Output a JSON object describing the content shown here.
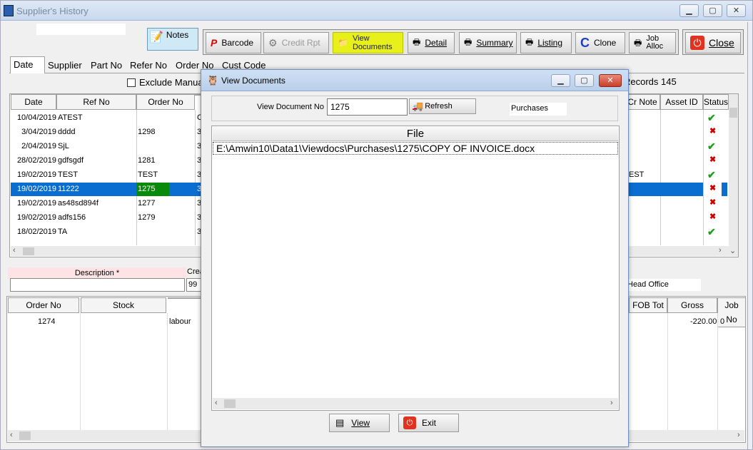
{
  "window": {
    "title": "Supplier's History"
  },
  "toolbar": {
    "notes": "Notes",
    "barcode": "Barcode",
    "credit_rpt": "Credit Rpt",
    "view_docs_line1": "View",
    "view_docs_line2": "Documents",
    "detail": "Detail",
    "summary": "Summary",
    "listing": "Listing",
    "clone": "Clone",
    "job_alloc_line1": "Job",
    "job_alloc_line2": "Alloc",
    "close": "Close"
  },
  "tabs": [
    "Date",
    "Supplier",
    "Part No",
    "Refer No",
    "Order No",
    "Cust Code"
  ],
  "exclude_label": "Exclude Manual",
  "records_label": "Records 145",
  "grid": {
    "headers": {
      "date": "Date",
      "ref": "Ref No",
      "order": "Order No",
      "cr_note": "Cr Note",
      "asset": "Asset ID",
      "status": "Status"
    },
    "rows": [
      {
        "date": "10/04/2019",
        "ref": "ATEST",
        "order": "",
        "o": "C",
        "cr": "",
        "asset": "",
        "status": "ok"
      },
      {
        "date": "3/04/2019",
        "ref": "dddd",
        "order": "1298",
        "o": "3",
        "cr": "",
        "asset": "",
        "status": "no"
      },
      {
        "date": "2/04/2019",
        "ref": "SjL",
        "order": "",
        "o": "3",
        "cr": "",
        "asset": "",
        "status": "ok"
      },
      {
        "date": "28/02/2019",
        "ref": "gdfsgdf",
        "order": "1281",
        "o": "3",
        "cr": "",
        "asset": "",
        "status": "no"
      },
      {
        "date": "19/02/2019",
        "ref": "TEST",
        "order": "TEST",
        "o": "3",
        "cr": "EST",
        "asset": "",
        "status": "ok"
      },
      {
        "date": "19/02/2019",
        "ref": "11222",
        "order": "1275",
        "o": "3",
        "cr": "",
        "asset": "",
        "status": "no"
      },
      {
        "date": "19/02/2019",
        "ref": "as48sd894f",
        "order": "1277",
        "o": "3",
        "cr": "",
        "asset": "",
        "status": "no"
      },
      {
        "date": "19/02/2019",
        "ref": "adfs156",
        "order": "1279",
        "o": "3",
        "cr": "",
        "asset": "",
        "status": "no"
      },
      {
        "date": "18/02/2019",
        "ref": "TA",
        "order": "",
        "o": "3",
        "cr": "",
        "asset": "",
        "status": "ok"
      }
    ]
  },
  "desc": {
    "label": "Description *",
    "crea_label": "Crea",
    "crea_value": "99",
    "office": "Head Office"
  },
  "lines": {
    "headers": {
      "order": "Order No",
      "stock": "Stock",
      "fob": "FOB Tot",
      "gross": "Gross",
      "job": "Job No"
    },
    "rows": [
      {
        "order": "1274",
        "stock": "",
        "desc": "labour",
        "fob": "",
        "gross": "-220.00",
        "job": "0"
      }
    ]
  },
  "dialog": {
    "title": "View Documents",
    "doc_no_label": "View Document No",
    "doc_no_value": "1275",
    "refresh": "Refresh",
    "category": "Purchases",
    "file_header": "File",
    "files": [
      "E:\\Amwin10\\Data1\\Viewdocs\\Purchases\\1275\\COPY OF INVOICE.docx"
    ],
    "view_btn": "View",
    "exit_btn": "Exit"
  },
  "colors": {
    "selection": "#0a6ed1",
    "accent_yellow": "#e8f01a",
    "close_red": "#e0321e",
    "ok_green": "#1aa01a",
    "no_red": "#d00000"
  }
}
